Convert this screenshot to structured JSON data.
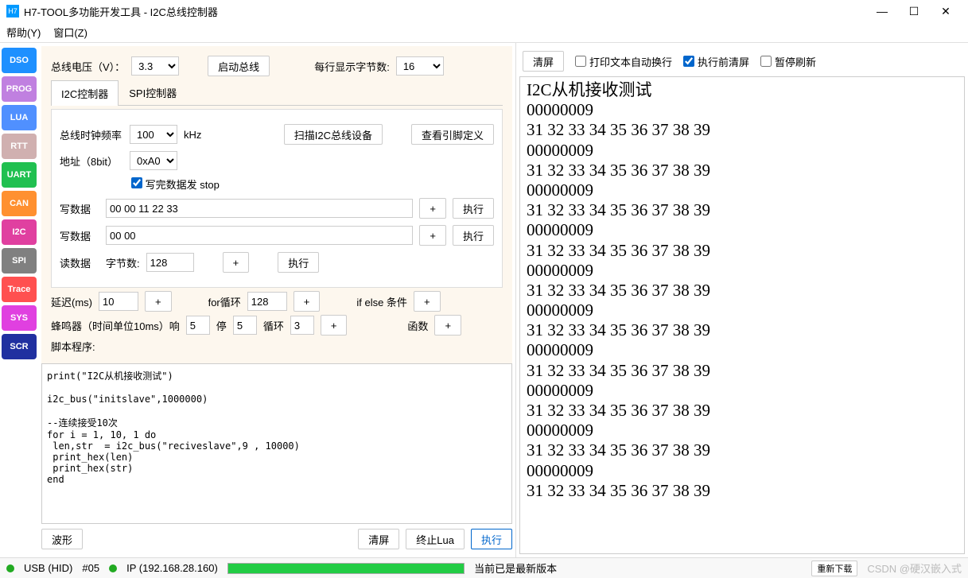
{
  "window": {
    "icon_text": "H7",
    "title": "H7-TOOL多功能开发工具 - I2C总线控制器"
  },
  "menu": {
    "help": "帮助(Y)",
    "window": "窗口(Z)"
  },
  "sidebar": [
    {
      "label": "DSO",
      "color": "#1e90ff"
    },
    {
      "label": "PROG",
      "color": "#c080e0"
    },
    {
      "label": "LUA",
      "color": "#5090ff"
    },
    {
      "label": "RTT",
      "color": "#d0b0b0"
    },
    {
      "label": "UART",
      "color": "#20c050"
    },
    {
      "label": "CAN",
      "color": "#ff9030"
    },
    {
      "label": "I2C",
      "color": "#e040a0"
    },
    {
      "label": "SPI",
      "color": "#808080"
    },
    {
      "label": "Trace",
      "color": "#ff5050"
    },
    {
      "label": "SYS",
      "color": "#e040e0"
    },
    {
      "label": "SCR",
      "color": "#2030a0"
    }
  ],
  "top": {
    "bus_voltage_label": "总线电压（V）：",
    "bus_voltage_value": "3.3",
    "start_bus": "启动总线",
    "line_bytes_label": "每行显示字节数:",
    "line_bytes_value": "16"
  },
  "tabs": {
    "i2c": "I2C控制器",
    "spi": "SPI控制器"
  },
  "i2c": {
    "clock_label": "总线时钟频率",
    "clock_value": "100",
    "clock_unit": "kHz",
    "scan_btn": "扫描I2C总线设备",
    "pin_def_btn": "查看引脚定义",
    "addr_label": "地址（8bit）",
    "addr_value": "0xA0",
    "write_stop_label": "写完数据发 stop",
    "write1_label": "写数据",
    "write1_value": "00 00 11 22 33",
    "write2_label": "写数据",
    "write2_value": "00 00",
    "read_label": "读数据",
    "read_bytes_label": "字节数:",
    "read_bytes_value": "128",
    "plus": "+",
    "exec": "执行"
  },
  "script": {
    "delay_label": "延迟(ms)",
    "delay_value": "10",
    "for_label": "for循环",
    "for_value": "128",
    "if_label": "if else 条件",
    "beep_label": "蜂鸣器（时间单位10ms）响",
    "beep_on": "5",
    "beep_stop_label": "停",
    "beep_stop": "5",
    "beep_loop_label": "循环",
    "beep_loop": "3",
    "func_label": "函数",
    "script_label": "脚本程序:",
    "script_text": "print(\"I2C从机接收测试\")\n\ni2c_bus(\"initslave\",1000000)\n\n--连续接受10次\nfor i = 1, 10, 1 do\n len,str  = i2c_bus(\"reciveslave\",9 , 10000)\n print_hex(len)\n print_hex(str)\nend",
    "wave_btn": "波形",
    "clear_btn": "清屏",
    "stop_lua_btn": "终止Lua",
    "exec_btn": "执行"
  },
  "right": {
    "clear_btn": "清屏",
    "auto_wrap": "打印文本自动换行",
    "clear_before": "执行前清屏",
    "pause": "暂停刷新",
    "output": "I2C从机接收测试\n00000009\n31 32 33 34 35 36 37 38 39\n00000009\n31 32 33 34 35 36 37 38 39\n00000009\n31 32 33 34 35 36 37 38 39\n00000009\n31 32 33 34 35 36 37 38 39\n00000009\n31 32 33 34 35 36 37 38 39\n00000009\n31 32 33 34 35 36 37 38 39\n00000009\n31 32 33 34 35 36 37 38 39\n00000009\n31 32 33 34 35 36 37 38 39\n00000009\n31 32 33 34 35 36 37 38 39\n00000009\n31 32 33 34 35 36 37 38 39"
  },
  "status": {
    "usb": "USB (HID)",
    "num": "#05",
    "ip": "IP (192.168.28.160)",
    "latest": "当前已是最新版本",
    "redownload": "重新下载",
    "watermark": "CSDN @硬汉嵌入式"
  }
}
